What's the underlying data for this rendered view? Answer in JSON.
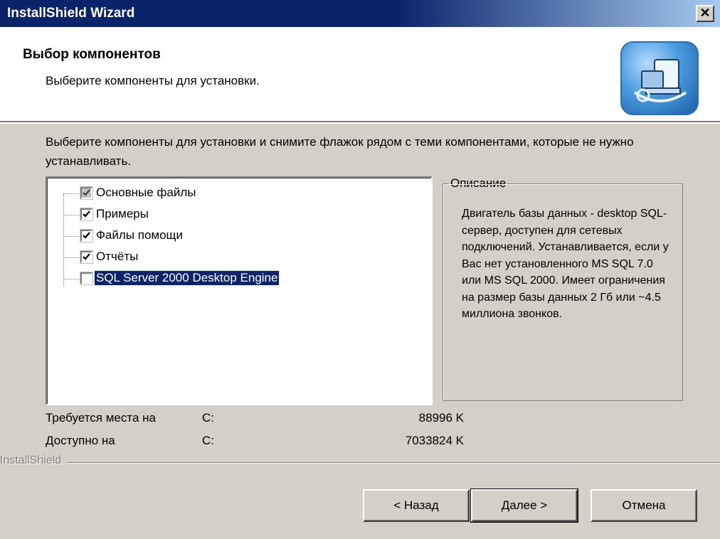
{
  "window": {
    "title": "InstallShield Wizard"
  },
  "header": {
    "title": "Выбор компонентов",
    "subtitle": "Выберите компоненты для установки."
  },
  "instructions": "Выберите компоненты для установки и снимите флажок рядом с теми компонентами, которые не нужно устанавливать.",
  "components": [
    {
      "label": "Основные файлы",
      "checked": true,
      "greyed": true
    },
    {
      "label": "Примеры",
      "checked": true,
      "greyed": false
    },
    {
      "label": "Файлы помощи",
      "checked": true,
      "greyed": false
    },
    {
      "label": "Отчёты",
      "checked": true,
      "greyed": false
    },
    {
      "label": "SQL Server 2000 Desktop Engine",
      "checked": false,
      "greyed": false,
      "selected": true
    }
  ],
  "description": {
    "legend": "Описание",
    "text": "Двигатель базы данных - desktop SQL-сервер, доступен для сетевых подключений. Устанавливается, если у Вас нет установленного MS SQL 7.0 или MS SQL 2000. Имеет ограничения на размер базы данных 2 Гб или ~4.5 миллиона звонков."
  },
  "space": {
    "required": {
      "label": "Требуется места на",
      "drive": "C:",
      "value": "88996 K"
    },
    "available": {
      "label": "Доступно на",
      "drive": "C:",
      "value": "7033824 K"
    }
  },
  "brand": "InstallShield",
  "buttons": {
    "back": "< Назад",
    "next": "Далее >",
    "cancel": "Отмена"
  },
  "colors": {
    "titlebar": "#0a246a",
    "selection": "#0a246a",
    "face": "#d4d0c8"
  },
  "icons": {
    "close": "close-icon",
    "header": "computer-install-icon"
  }
}
